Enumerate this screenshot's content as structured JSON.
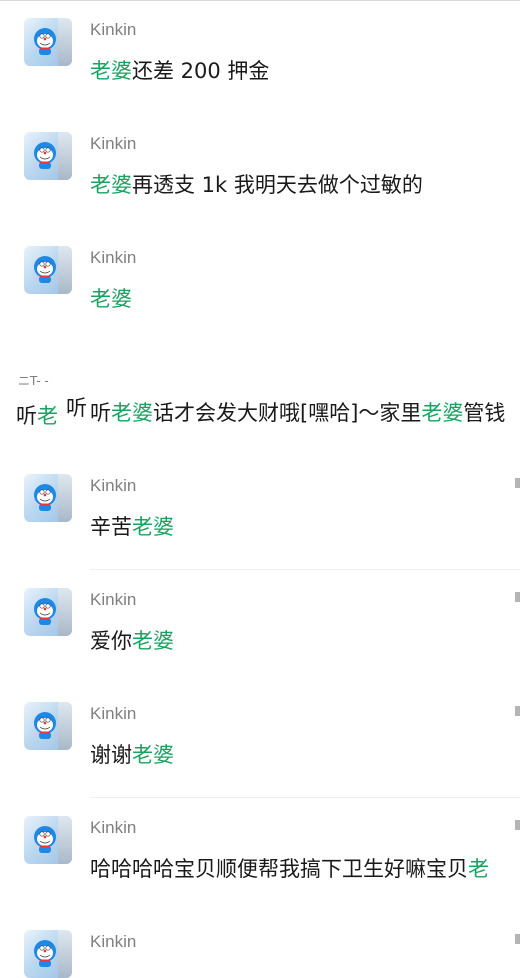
{
  "chat": {
    "messages": [
      {
        "sender": "Kinkin",
        "segments": [
          {
            "t": "老婆",
            "hl": true
          },
          {
            "t": "还差 200 押金",
            "hl": false
          }
        ]
      },
      {
        "sender": "Kinkin",
        "segments": [
          {
            "t": "老婆",
            "hl": true
          },
          {
            "t": "再透支 1k 我明天去做个过敏的",
            "hl": false
          }
        ]
      },
      {
        "sender": "Kinkin",
        "segments": [
          {
            "t": "老婆",
            "hl": true
          }
        ]
      },
      {
        "sender": "",
        "segments": [
          {
            "t": "听",
            "hl": false
          },
          {
            "t": "老婆",
            "hl": true
          },
          {
            "t": "话才会发大财哦[嘿哈]～家里",
            "hl": false
          },
          {
            "t": "老婆",
            "hl": true
          },
          {
            "t": "管钱",
            "hl": false
          }
        ]
      },
      {
        "sender": "Kinkin",
        "segments": [
          {
            "t": "辛苦",
            "hl": false
          },
          {
            "t": "老婆",
            "hl": true
          }
        ]
      },
      {
        "sender": "Kinkin",
        "segments": [
          {
            "t": "爱你",
            "hl": false
          },
          {
            "t": "老婆",
            "hl": true
          }
        ]
      },
      {
        "sender": "Kinkin",
        "segments": [
          {
            "t": "谢谢",
            "hl": false
          },
          {
            "t": "老婆",
            "hl": true
          }
        ]
      },
      {
        "sender": "Kinkin",
        "segments": [
          {
            "t": "哈哈哈哈宝贝顺便帮我搞下卫生好嘛宝贝",
            "hl": false
          },
          {
            "t": "老",
            "hl": true
          }
        ]
      },
      {
        "sender": "Kinkin",
        "segments": []
      }
    ],
    "partial_avatar": {
      "top_text": "ニT- -",
      "left_prefix": "听",
      "left_highlight": "老",
      "right_text": "听"
    }
  },
  "colors": {
    "highlight": "#1aa260",
    "sender_name": "#808080",
    "message_text": "#1a1a1a",
    "divider": "#efefef"
  },
  "icons": {
    "avatar": "doraemon-avatar-icon"
  }
}
